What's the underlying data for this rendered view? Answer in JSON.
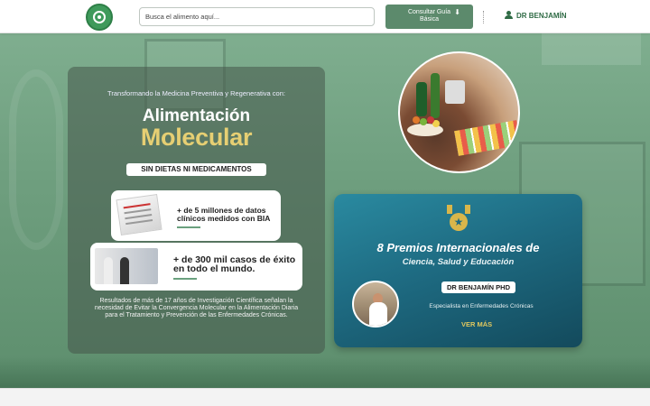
{
  "header": {
    "search_placeholder": "Busca el alimento aquí...",
    "consult_label_line1": "Consultar Guía",
    "consult_label_line2": "Básica",
    "user_name": "DR BENJAMÍN"
  },
  "hero": {
    "tagline": "Transformando la Medicina Preventiva y Regenerativa con:",
    "title_line1": "Alimentación",
    "title_line2": "Molecular",
    "badge": "SIN DIETAS NI MEDICAMENTOS",
    "card1_text": "+ de 5 millones de datos clínicos medidos con BIA",
    "card2_text": "+ de 300 mil casos de éxito en todo el mundo.",
    "description": "Resultados de más de 17 años de Investigación Científica señalan la necesidad de Evitar la Convergencia Molecular en la Alimentación Diaria para el Tratamiento y Prevención de las Enfermedades Crónicas."
  },
  "award": {
    "title": "8 Premios Internacionales de",
    "subtitle": "Ciencia, Salud y Educación",
    "name": "DR BENJAMÍN PHD",
    "specialty": "Especialista en Enfermedades Crónicas",
    "more_label": "VER MÁS"
  },
  "colors": {
    "brand_green": "#3f9a5b",
    "consult_button": "#5c8a6c",
    "gold": "#e6cf73",
    "award_teal": "#1e6b82"
  },
  "icons": [
    "logo-icon",
    "download-icon",
    "user-icon",
    "medal-icon"
  ]
}
